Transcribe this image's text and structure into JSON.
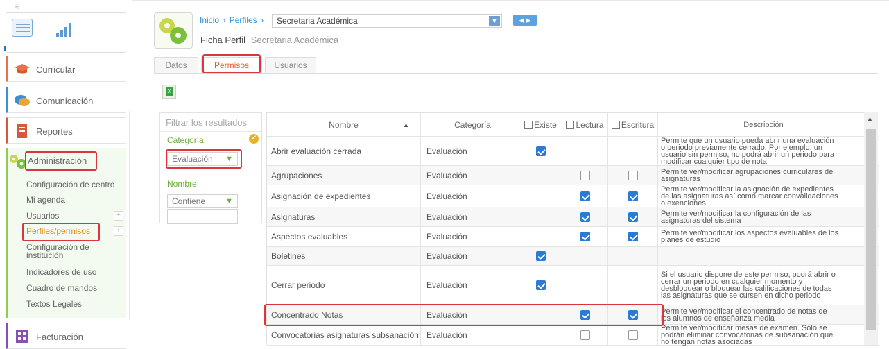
{
  "sidebar": {
    "top_tip": "ॢ ",
    "sections": {
      "curricular": "Curricular",
      "comunicacion": "Comunicación",
      "reportes": "Reportes",
      "administracion": "Administración",
      "facturacion": "Facturación"
    },
    "admin_items": [
      "Configuración de centro",
      "Mi agenda",
      "Usuarios",
      "Perfiles/permisos",
      "Configuración de",
      "institución",
      "Indicadores de uso",
      "Cuadro de mandos",
      "Textos Legales"
    ],
    "plus": "+",
    "colors": {
      "admin_accent": "#93c956",
      "active_item": "#e78a17"
    }
  },
  "header": {
    "breadcrumb": [
      "Inicio",
      "›",
      "Perfiles",
      "›"
    ],
    "profile_select": "Secretaria Académica",
    "select_arrow": "▼",
    "nav_arrows": "◀ ▶",
    "ficha_label": "Ficha Perfil",
    "ficha_sub": "Secretaria Académica"
  },
  "tabs": [
    "Datos",
    "Permisos",
    "Usuarios"
  ],
  "export_icon": "X",
  "filter": {
    "title": "Filtrar los resultados",
    "categoria_label": "Categoría",
    "categoria_value": "Evaluación",
    "nombre_label": "Nombre",
    "nombre_op": "Contiene",
    "arrow": "▼",
    "check": "✔"
  },
  "table": {
    "headers": {
      "nombre": "Nombre",
      "categoria": "Categoría",
      "existe": "Existe",
      "lectura": "Lectura",
      "escritura": "Escritura",
      "descripcion": "Descripción"
    },
    "sort_arrow": "▲",
    "rows": [
      {
        "nombre": "Abrir evaluación cerrada",
        "categoria": "Evaluación",
        "desc": [
          "Permite que un usuario pueda abrir una evaluación",
          "o periodo previamente cerrado. Por ejemplo, un",
          "usuario sin permiso, no podrá abrir un periodo para",
          "modificar cualquier tipo de nota"
        ]
      },
      {
        "nombre": "Agrupaciones",
        "categoria": "Evaluación",
        "desc": [
          "Permite ver/modificar agrupaciones curriculares de",
          "asignaturas"
        ]
      },
      {
        "nombre": "Asignación de expedientes",
        "categoria": "Evaluación",
        "desc": [
          "Permite ver/modificar la asignación de expedientes",
          "de las asignaturas así como marcar convalidaciones",
          "o exenciones"
        ]
      },
      {
        "nombre": "Asignaturas",
        "categoria": "Evaluación",
        "desc": [
          "Permite ver/modificar la configuración de las",
          "asignaturas del sistema"
        ]
      },
      {
        "nombre": "Aspectos evaluables",
        "categoria": "Evaluación",
        "desc": [
          "Permite ver/modificar los aspectos evaluables de los",
          "planes de estudio"
        ]
      },
      {
        "nombre": "Boletines",
        "categoria": "Evaluación",
        "desc": []
      },
      {
        "nombre": "Cerrar periodo",
        "categoria": "Evaluación",
        "desc": [
          "Si el usuario dispone de este permiso, podrá abrir o",
          "cerrar un periodo en cualquier momento y",
          "desbloquear o bloquear las calificaciones de todas",
          "las asignaturas que se cursen en dicho periodo"
        ]
      },
      {
        "nombre": "Concentrado Notas",
        "categoria": "Evaluación",
        "desc": [
          "Permite ver/modificar el concentrado de notas de",
          "los alumnos de enseñanza media"
        ]
      },
      {
        "nombre": "Convocatorias asignaturas subsanación",
        "categoria": "Evaluación",
        "desc": [
          "Permite ver/modificar mesas de examen. Sólo se",
          "podrán eliminar convocatorias de subsanación que",
          "no tengan notas asociadas"
        ]
      }
    ],
    "checks": [
      [
        true,
        null,
        null
      ],
      [
        null,
        false,
        false
      ],
      [
        null,
        true,
        true
      ],
      [
        null,
        true,
        true
      ],
      [
        null,
        true,
        true
      ],
      [
        true,
        null,
        null
      ],
      [
        true,
        null,
        null
      ],
      [
        null,
        true,
        true
      ],
      [
        null,
        false,
        false
      ]
    ],
    "scroll_up": "▲"
  }
}
